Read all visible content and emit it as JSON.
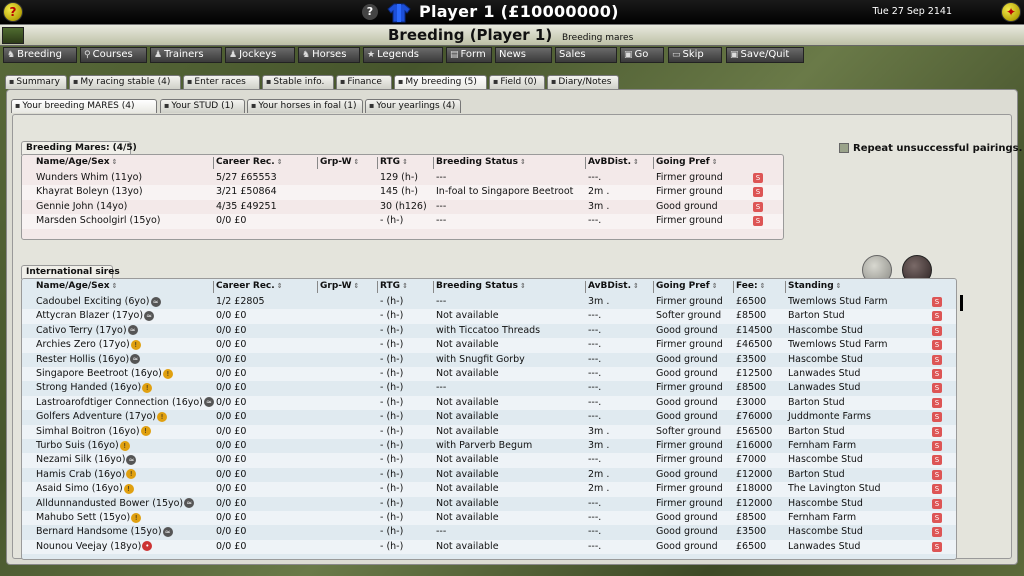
{
  "topbar": {
    "help_label": "?",
    "info_label": "?",
    "player_title": "Player 1  (£10000000)",
    "datetime": "Tue 27 Sep 2141"
  },
  "header": {
    "title": "Breeding (Player 1)",
    "subtitle": "Breeding mares"
  },
  "nav": [
    {
      "label": "Breeding",
      "icon": "horse-icon"
    },
    {
      "label": "Courses",
      "icon": "pin-icon"
    },
    {
      "label": "Trainers",
      "icon": "person-icon"
    },
    {
      "label": "Jockeys",
      "icon": "person-icon"
    },
    {
      "label": "Horses",
      "icon": "horse-icon"
    },
    {
      "label": "Legends",
      "icon": "star-icon"
    },
    {
      "label": "Form",
      "icon": "form-icon"
    },
    {
      "label": "News",
      "icon": ""
    },
    {
      "label": "Sales",
      "icon": ""
    },
    {
      "label": "Go",
      "icon": "go-icon"
    },
    {
      "label": "Skip",
      "icon": "skip-icon"
    },
    {
      "label": "Save/Quit",
      "icon": "save-icon"
    }
  ],
  "tabs": [
    "Summary",
    "My racing stable (4)",
    "Enter races",
    "Stable info.",
    "Finance",
    "My breeding (5)",
    "Field (0)",
    "Diary/Notes"
  ],
  "subtabs": [
    "Your breeding MARES (4)",
    "Your STUD (1)",
    "Your horses in foal (1)",
    "Your yearlings (4)"
  ],
  "repeat_label": "Repeat unsuccessful pairings.",
  "mares": {
    "group_title": "Breeding Mares: (4/5)",
    "headers": [
      "Name/Age/Sex",
      "Career Rec.",
      "Grp-W",
      "RTG",
      "Breeding Status",
      "AvBDist.",
      "Going Pref"
    ],
    "rows": [
      [
        "Wunders Whim (11yo)",
        "5/27  £65553",
        "",
        "129 (h-)",
        "---",
        "---.",
        "Firmer ground"
      ],
      [
        "Khayrat Boleyn (13yo)",
        "3/21  £50864",
        "",
        "145 (h-)",
        "In-foal to Singapore Beetroot",
        "2m .",
        "Firmer ground"
      ],
      [
        "Gennie John (14yo)",
        "4/35  £49251",
        "",
        "30 (h126)",
        "---",
        "3m .",
        "Good ground"
      ],
      [
        "Marsden Schoolgirl (15yo)",
        "0/0  £0",
        "",
        "- (h-)",
        "---",
        "---.",
        "Firmer ground"
      ]
    ]
  },
  "sires": {
    "group_title": "International sires",
    "headers": [
      "Name/Age/Sex",
      "Career Rec.",
      "Grp-W",
      "RTG",
      "Breeding Status",
      "AvBDist.",
      "Going Pref",
      "Fee:",
      "Standing"
    ],
    "rows": [
      [
        "Cadoubel Exciting (6yo)",
        "grey",
        "1/2  £2805",
        "- (h-)",
        "---",
        "3m .",
        "Firmer ground",
        "£6500",
        "Twemlows Stud Farm"
      ],
      [
        "Attycran Blazer (17yo)",
        "grey",
        "0/0  £0",
        "- (h-)",
        "Not available",
        "---.",
        "Softer ground",
        "£8500",
        "Barton Stud"
      ],
      [
        "Cativo Terry (17yo)",
        "grey",
        "0/0  £0",
        "- (h-)",
        "with Ticcatoo Threads",
        "---.",
        "Good ground",
        "£14500",
        "Hascombe Stud"
      ],
      [
        "Archies Zero (17yo)",
        "gold",
        "0/0  £0",
        "- (h-)",
        "Not available",
        "---.",
        "Firmer ground",
        "£46500",
        "Twemlows Stud Farm"
      ],
      [
        "Rester Hollis (16yo)",
        "grey",
        "0/0  £0",
        "- (h-)",
        "with Snugfit Gorby",
        "---.",
        "Good ground",
        "£3500",
        "Hascombe Stud"
      ],
      [
        "Singapore Beetroot (16yo)",
        "gold",
        "0/0  £0",
        "- (h-)",
        "Not available",
        "---.",
        "Good ground",
        "£12500",
        "Lanwades Stud"
      ],
      [
        "Strong Handed (16yo)",
        "gold",
        "0/0  £0",
        "- (h-)",
        "---",
        "---.",
        "Firmer ground",
        "£8500",
        "Lanwades Stud"
      ],
      [
        "Lastroarofdtiger Connection (16yo)",
        "grey",
        "0/0  £0",
        "- (h-)",
        "Not available",
        "---.",
        "Good ground",
        "£3000",
        "Barton Stud"
      ],
      [
        "Golfers Adventure (17yo)",
        "gold",
        "0/0  £0",
        "- (h-)",
        "Not available",
        "---.",
        "Good ground",
        "£76000",
        "Juddmonte Farms"
      ],
      [
        "Simhal Boitron (16yo)",
        "gold",
        "0/0  £0",
        "- (h-)",
        "Not available",
        "3m .",
        "Softer ground",
        "£56500",
        "Barton Stud"
      ],
      [
        "Turbo Suis (16yo)",
        "gold",
        "0/0  £0",
        "- (h-)",
        "with Parverb Begum",
        "3m .",
        "Firmer ground",
        "£16000",
        "Fernham Farm"
      ],
      [
        "Nezami Silk (16yo)",
        "grey",
        "0/0  £0",
        "- (h-)",
        "Not available",
        "---.",
        "Firmer ground",
        "£7000",
        "Hascombe Stud"
      ],
      [
        "Hamis Crab (16yo)",
        "gold",
        "0/0  £0",
        "- (h-)",
        "Not available",
        "2m .",
        "Good ground",
        "£12000",
        "Barton Stud"
      ],
      [
        "Asaid Simo (16yo)",
        "gold",
        "0/0  £0",
        "- (h-)",
        "Not available",
        "2m .",
        "Firmer ground",
        "£18000",
        "The Lavington Stud"
      ],
      [
        "Alldunnandusted Bower (15yo)",
        "grey",
        "0/0  £0",
        "- (h-)",
        "Not available",
        "---.",
        "Firmer ground",
        "£12000",
        "Hascombe Stud"
      ],
      [
        "Mahubo Sett (15yo)",
        "gold",
        "0/0  £0",
        "- (h-)",
        "Not available",
        "---.",
        "Good ground",
        "£8500",
        "Fernham Farm"
      ],
      [
        "Bernard Handsome (15yo)",
        "grey",
        "0/0  £0",
        "- (h-)",
        "---",
        "---.",
        "Good ground",
        "£3500",
        "Hascombe Stud"
      ],
      [
        "Nounou Veejay (18yo)",
        "red",
        "0/0  £0",
        "- (h-)",
        "Not available",
        "---.",
        "Good ground",
        "£6500",
        "Lanwades Stud"
      ]
    ]
  }
}
